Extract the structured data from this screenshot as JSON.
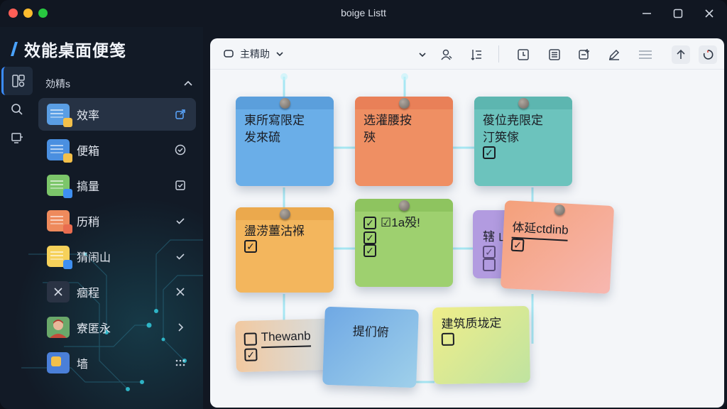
{
  "window": {
    "title": "boige Listt"
  },
  "sidebar": {
    "brand": "效能桌面便笺",
    "group_title": "効精s",
    "items": [
      {
        "label": "效率",
        "icon": "blue-note-icon",
        "trail": "share-icon",
        "active": true
      },
      {
        "label": "便箱",
        "icon": "blue-note-icon",
        "trail": "check-circle-icon"
      },
      {
        "label": "搞量",
        "icon": "green-note-icon",
        "trail": "check-square-icon"
      },
      {
        "label": "历稍",
        "icon": "orange-note-icon",
        "trail": "check-icon"
      },
      {
        "label": "猜闹山",
        "icon": "yellow-note-icon",
        "trail": "check-icon"
      },
      {
        "label": "痼程",
        "icon": "close-icon",
        "trail": "close-icon"
      },
      {
        "label": "寮匿永",
        "icon": "avatar-icon",
        "trail": "chevron-right-icon"
      },
      {
        "label": "墙",
        "icon": "puzzle-icon",
        "trail": "grip-icon"
      }
    ]
  },
  "toolbar": {
    "dropdown_label": "主精助"
  },
  "notes": [
    {
      "color": "#6aaee8",
      "tab": "#5b9fdc",
      "lines": [
        {
          "text": "東所寫限定"
        },
        {
          "text": "发來硫"
        }
      ]
    },
    {
      "color": "#ef8f63",
      "tab": "#e98058",
      "lines": [
        {
          "text": "选灌腰按"
        },
        {
          "text": "殎"
        }
      ]
    },
    {
      "color": "#6cc3bd",
      "tab": "#5db6b0",
      "lines": [
        {
          "text": "葰位尭限定"
        },
        {
          "text": "汀筴傢"
        },
        {
          "text": "",
          "checkbox": "checked"
        }
      ]
    },
    {
      "color": "#f3b65d",
      "tab": "#eba94d",
      "lines": [
        {
          "text": "盪涝薑沽褓"
        },
        {
          "text": "",
          "checkbox": "checked"
        }
      ]
    },
    {
      "color": "#9ed06f",
      "tab": "#8ec45f",
      "lines": [
        {
          "text": "☑1a殁!",
          "checkbox": "checked"
        },
        {
          "text": "",
          "checkbox": "checked"
        },
        {
          "text": "",
          "checkbox": "checked"
        }
      ]
    },
    {
      "color": "#b29be0",
      "tab": "#a48bd8",
      "lines": [
        {
          "text": "辖 山"
        },
        {
          "text": "",
          "checkbox": "checked"
        },
        {
          "text": "",
          "checkbox": "empty"
        }
      ]
    },
    {
      "color": "#f5a08a",
      "tab": "#f5a08a",
      "lines": [
        {
          "text": "体延ctdinb",
          "underline": true
        },
        {
          "text": "",
          "checkbox": "checked"
        }
      ]
    },
    {
      "color": "#f2c9a0",
      "tab": "#f2c9a0",
      "lines": [
        {
          "text": "Thewanb",
          "checkbox": "empty",
          "underline": true
        },
        {
          "text": "",
          "checkbox": "checked"
        }
      ]
    },
    {
      "color": "#7fb6e6",
      "tab": "#7fb6e6",
      "lines": [
        {
          "text": "提们俯"
        }
      ]
    },
    {
      "color": "#e9ec8d",
      "tab": "#e9ec8d",
      "lines": [
        {
          "text": "建筑质垅定"
        },
        {
          "text": "",
          "checkbox": "empty"
        }
      ]
    }
  ]
}
